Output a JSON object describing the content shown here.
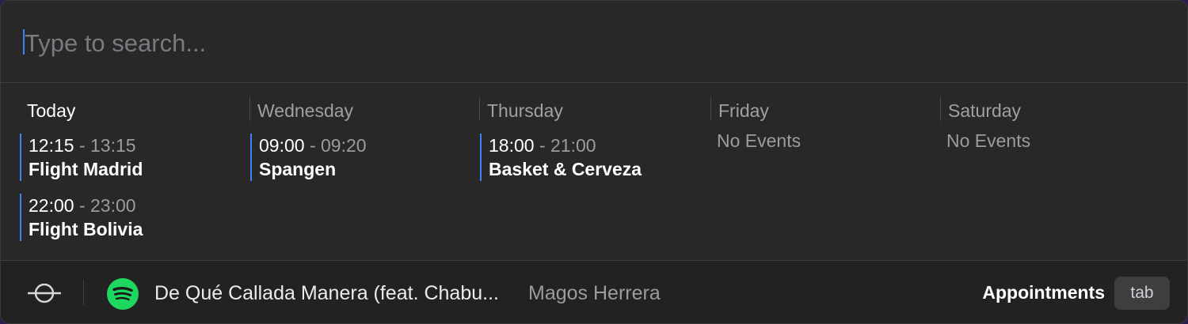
{
  "search": {
    "placeholder": "Type to search..."
  },
  "days": [
    {
      "name": "Today",
      "events": [
        {
          "start": "12:15",
          "sep": " - ",
          "end": "13:15",
          "title": "Flight Madrid"
        },
        {
          "start": "22:00",
          "sep": " - ",
          "end": "23:00",
          "title": "Flight Bolivia"
        }
      ]
    },
    {
      "name": "Wednesday",
      "events": [
        {
          "start": "09:00",
          "sep": " - ",
          "end": "09:20",
          "title": "Spangen"
        }
      ]
    },
    {
      "name": "Thursday",
      "events": [
        {
          "start": "18:00",
          "sep": " - ",
          "end": "21:00",
          "title": "Basket & Cerveza"
        }
      ]
    },
    {
      "name": "Friday",
      "no_events": "No Events"
    },
    {
      "name": "Saturday",
      "no_events": "No Events"
    }
  ],
  "footer": {
    "now_playing_title": "De Qué Callada Manera (feat. Chabu...",
    "now_playing_artist": "Magos Herrera",
    "action_label": "Appointments",
    "action_key": "tab"
  },
  "icons": {
    "app": "raycast-icon",
    "player": "spotify-icon"
  },
  "colors": {
    "accent": "#3b82f6",
    "spotify": "#1ed760",
    "background": "#282828"
  }
}
